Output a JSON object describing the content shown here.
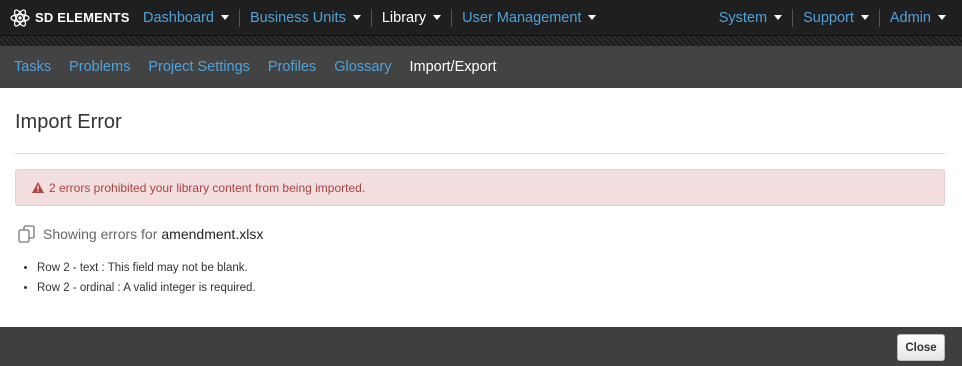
{
  "brand": {
    "name": "SD ELEMENTS"
  },
  "topnav": {
    "left": [
      {
        "label": "Dashboard",
        "dropdown": true,
        "active": false
      },
      {
        "label": "Business Units",
        "dropdown": true,
        "active": false
      },
      {
        "label": "Library",
        "dropdown": true,
        "active": true
      },
      {
        "label": "User Management",
        "dropdown": true,
        "active": false
      }
    ],
    "right": [
      {
        "label": "System",
        "dropdown": true
      },
      {
        "label": "Support",
        "dropdown": true
      },
      {
        "label": "Admin",
        "dropdown": true
      }
    ]
  },
  "subnav": {
    "tabs": [
      {
        "label": "Tasks"
      },
      {
        "label": "Problems"
      },
      {
        "label": "Project Settings"
      },
      {
        "label": "Profiles"
      },
      {
        "label": "Glossary"
      },
      {
        "label": "Import/Export",
        "active": true
      }
    ]
  },
  "modal": {
    "title": "Import Error",
    "alert": "2 errors prohibited your library content from being imported.",
    "showing_label": "Showing errors for",
    "filename": "amendment.xlsx",
    "errors": [
      "Row 2 - text : This field may not be blank.",
      "Row 2 - ordinal : A valid integer is required."
    ],
    "close_label": "Close"
  },
  "colors": {
    "link": "#4fa3dc",
    "alert_bg": "#f2dede",
    "alert_text": "#a94442"
  },
  "icons": [
    "sd-elements-logo-icon",
    "caret-down-icon",
    "warning-icon",
    "copy-icon"
  ]
}
